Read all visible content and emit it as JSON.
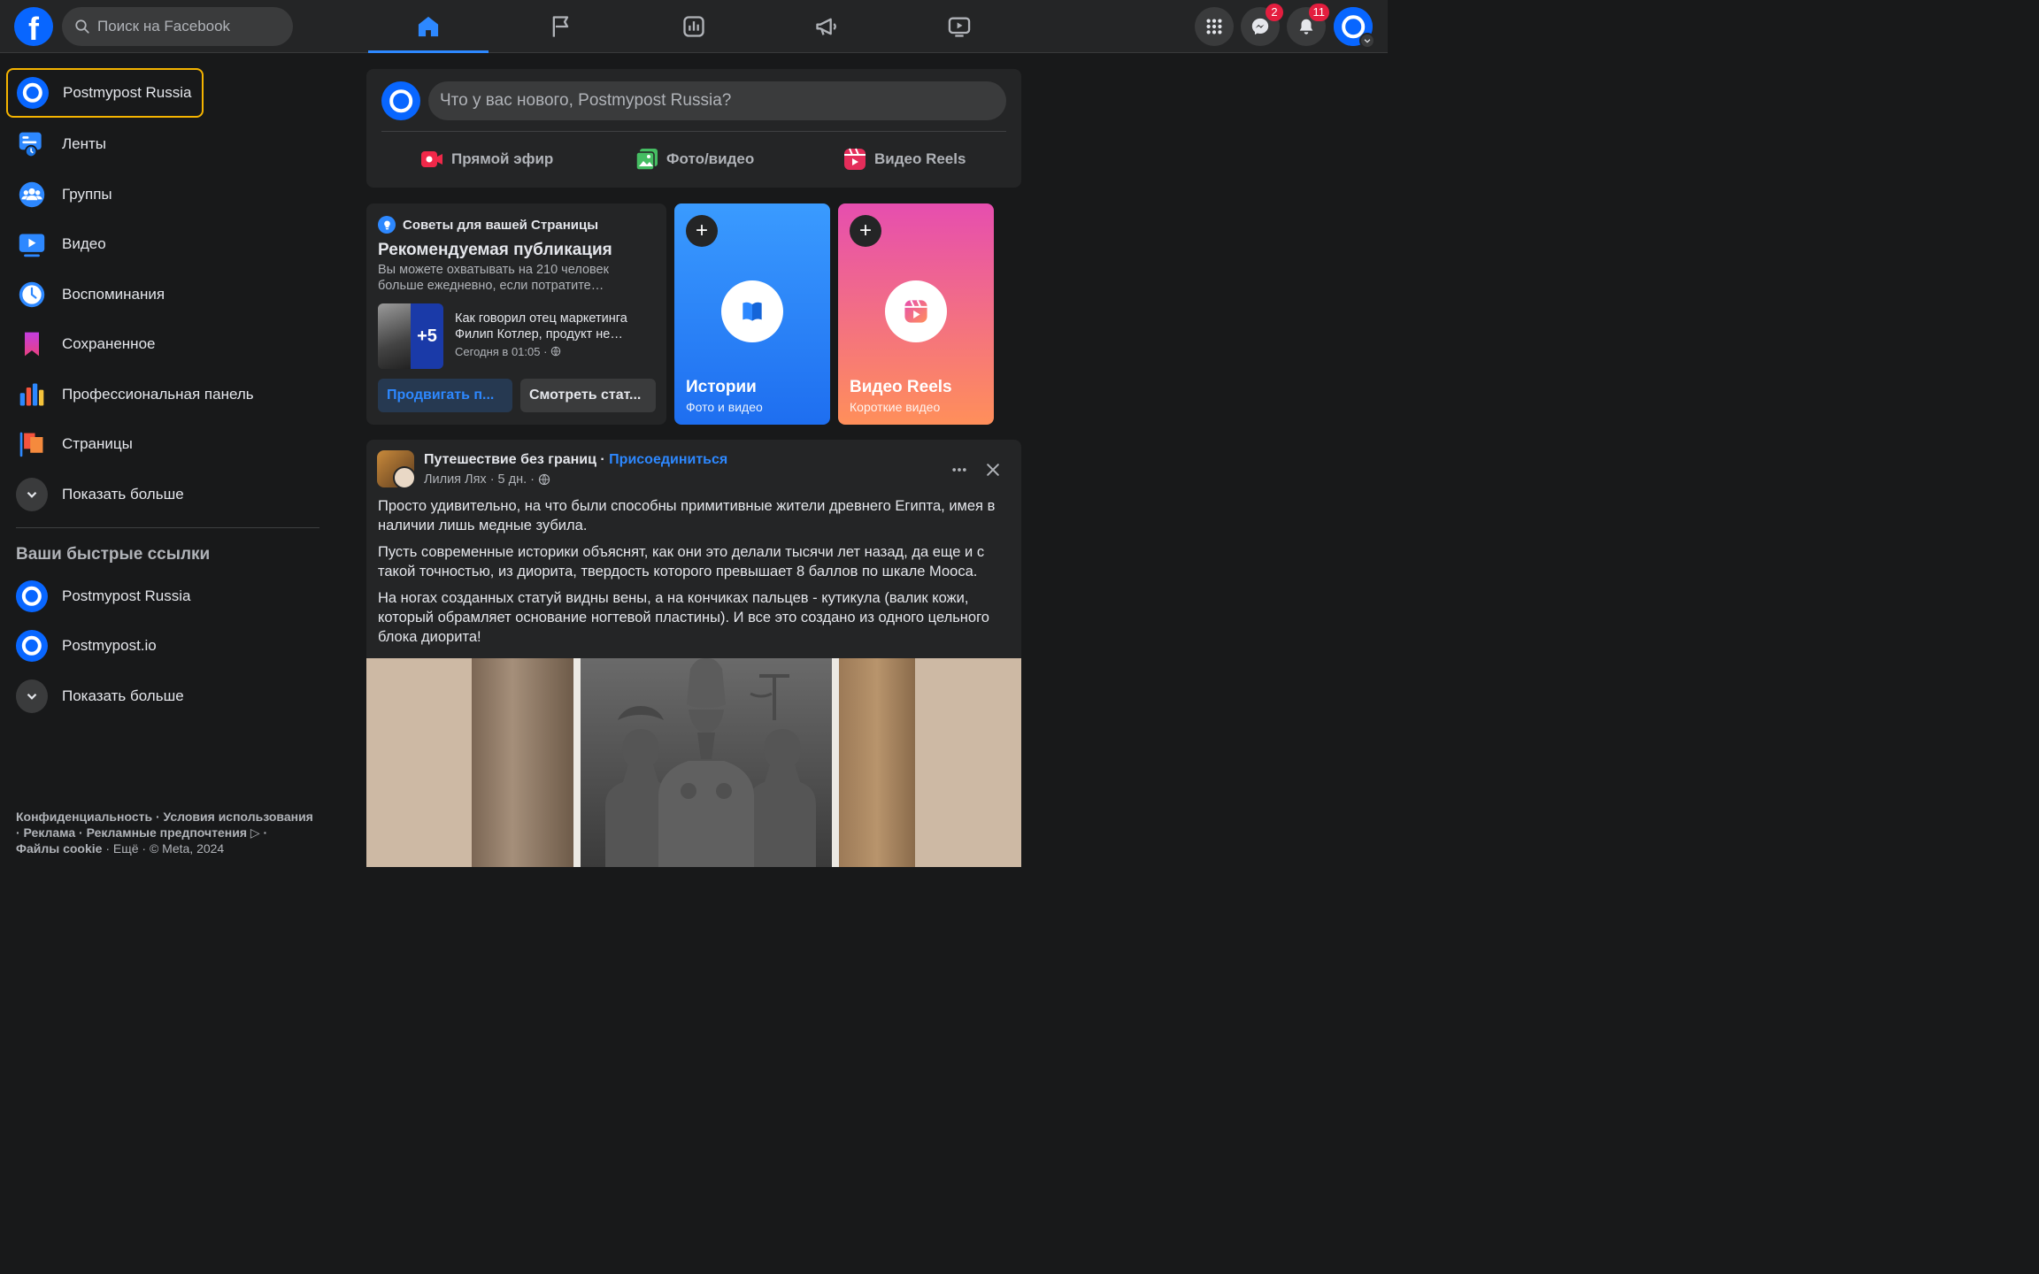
{
  "topbar": {
    "logo": "f",
    "search_placeholder": "Поиск на Facebook",
    "nav": [
      "home-icon",
      "flag-icon",
      "insights-icon",
      "megaphone-icon",
      "video-icon"
    ],
    "messenger_badge": "2",
    "notifications_badge": "11"
  },
  "sidebar": {
    "items": [
      {
        "label": "Postmypost Russia"
      },
      {
        "label": "Ленты"
      },
      {
        "label": "Группы"
      },
      {
        "label": "Видео"
      },
      {
        "label": "Воспоминания"
      },
      {
        "label": "Сохраненное"
      },
      {
        "label": "Профессиональная панель"
      },
      {
        "label": "Страницы"
      },
      {
        "label": "Показать больше"
      }
    ],
    "shortcuts_title": "Ваши быстрые ссылки",
    "shortcuts": [
      {
        "label": "Postmypost Russia"
      },
      {
        "label": "Postmypost.io"
      },
      {
        "label": "Показать больше"
      }
    ],
    "footer": {
      "line1": "Конфиденциальность · Условия использования",
      "line2": "· Реклама · Рекламные предпочтения ▷ ·",
      "line3_cookies": "Файлы cookie",
      "line3_rest": " · Ещё · © Meta, 2024"
    }
  },
  "composer": {
    "placeholder": "Что у вас нового, Postmypost Russia?",
    "live": "Прямой эфир",
    "photo": "Фото/видео",
    "reels": "Видео Reels"
  },
  "tips": {
    "header": "Советы для вашей Страницы",
    "title": "Рекомендуемая публикация",
    "description": "Вы можете охватывать на 210 человек больше ежедневно, если потратите…",
    "thumb_count": "+5",
    "post_text": "Как говорил отец маркетинга Филип Котлер, продукт не…",
    "post_time": "Сегодня в 01:05 ·",
    "promote_button": "Продвигать п...",
    "stats_button": "Смотреть стат..."
  },
  "stories": {
    "title": "Истории",
    "subtitle": "Фото и видео"
  },
  "reels_tile": {
    "title": "Видео Reels",
    "subtitle": "Короткие видео"
  },
  "post": {
    "group": "Путешествие без границ",
    "separator": " · ",
    "join": "Присоединиться",
    "author_meta": "Лилия Лях · 5 дн. ·",
    "paragraphs": [
      "Просто удивительно, на что были способны примитивные жители древнего Египта, имея в наличии лишь медные зубила.",
      "Пусть современные историки объяснят, как они это делали тысячи лет назад, да еще и с такой точностью, из диорита, твердость которого превышает 8 баллов по шкале Мооса.",
      "На ногах созданных статуй видны вены, а на кончиках пальцев - кутикула (валик кожи, который обрамляет основание ногтевой пластины). И все это создано из одного цельного блока диорита!"
    ]
  },
  "colors": {
    "background": "#18191a",
    "surface": "#242526",
    "accent": "#2d88ff",
    "highlight": "#f5b400",
    "badge": "#e41e3f"
  }
}
